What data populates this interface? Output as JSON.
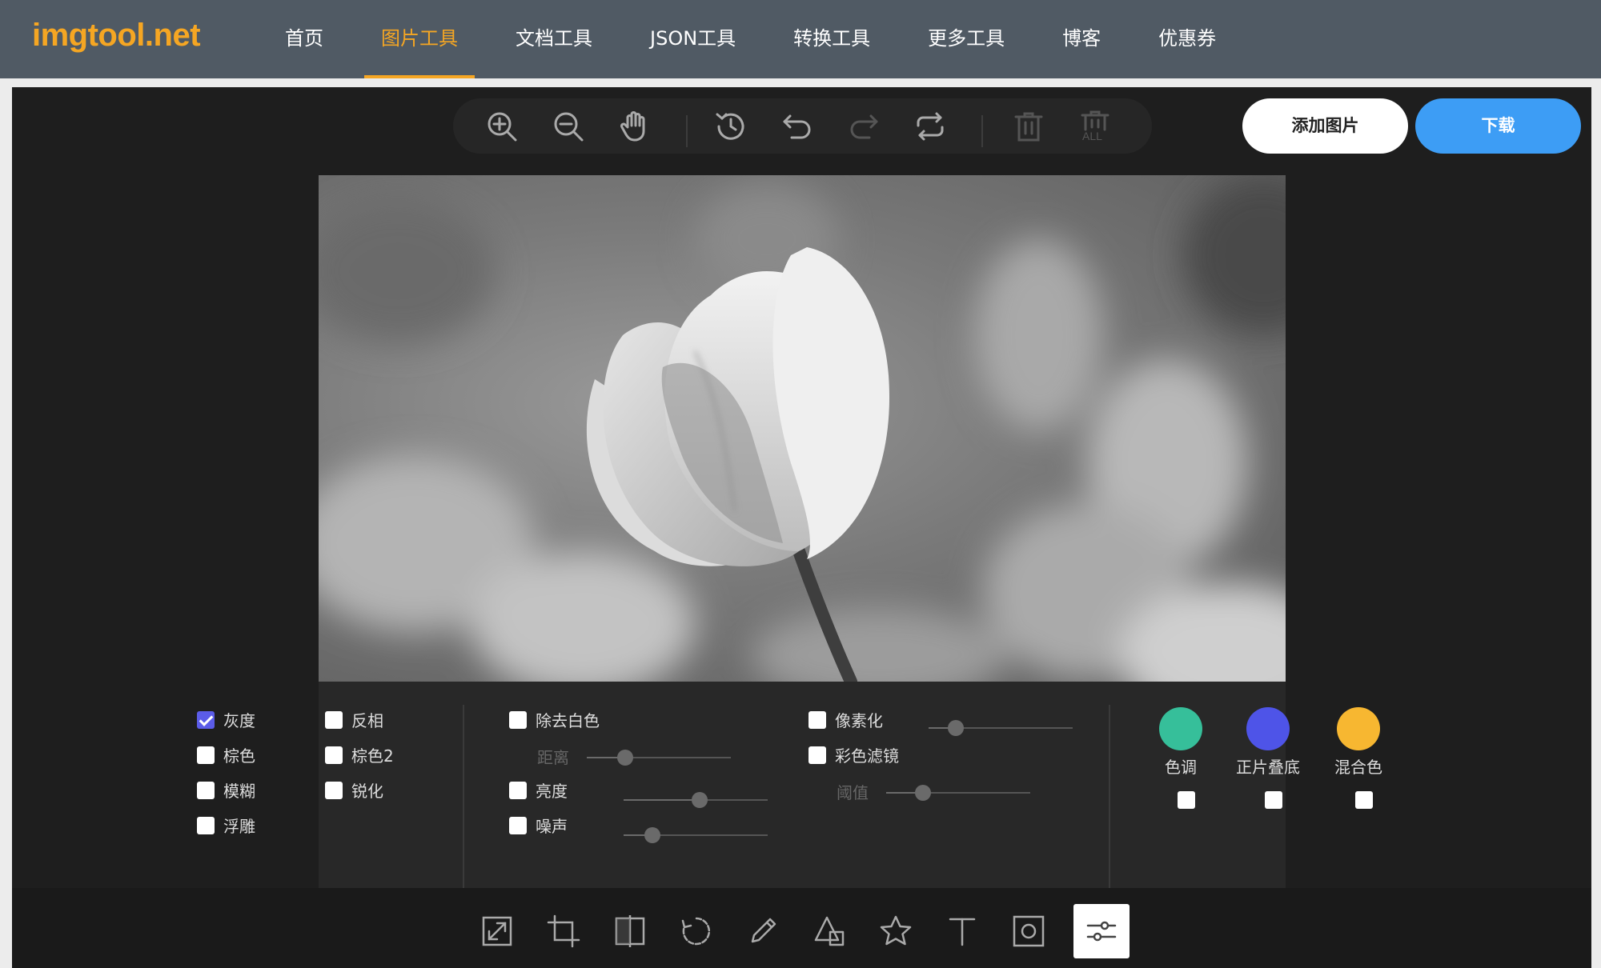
{
  "header": {
    "logo": "imgtool.net",
    "nav": [
      {
        "label": "首页",
        "active": false
      },
      {
        "label": "图片工具",
        "active": true
      },
      {
        "label": "文档工具",
        "active": false
      },
      {
        "label": "JSON工具",
        "active": false
      },
      {
        "label": "转换工具",
        "active": false
      },
      {
        "label": "更多工具",
        "active": false
      },
      {
        "label": "博客",
        "active": false
      },
      {
        "label": "优惠券",
        "active": false
      }
    ]
  },
  "toolbar": {
    "add_image_label": "添加图片",
    "download_label": "下载",
    "clear_all_text": "ALL"
  },
  "filters": {
    "grayscale": "灰度",
    "sepia": "棕色",
    "blur": "模糊",
    "emboss": "浮雕",
    "invert": "反相",
    "sepia2": "棕色2",
    "sharpen": "锐化",
    "remove_white": "除去白色",
    "distance": "距离",
    "brightness": "亮度",
    "noise": "噪声",
    "pixelate": "像素化",
    "color_filter": "彩色滤镜",
    "threshold": "阈值"
  },
  "colors": {
    "tint": {
      "label": "色调",
      "color": "#36bf9a"
    },
    "multiply": {
      "label": "正片叠底",
      "color": "#4e54e8"
    },
    "blend": {
      "label": "混合色",
      "color": "#f7b731"
    }
  }
}
